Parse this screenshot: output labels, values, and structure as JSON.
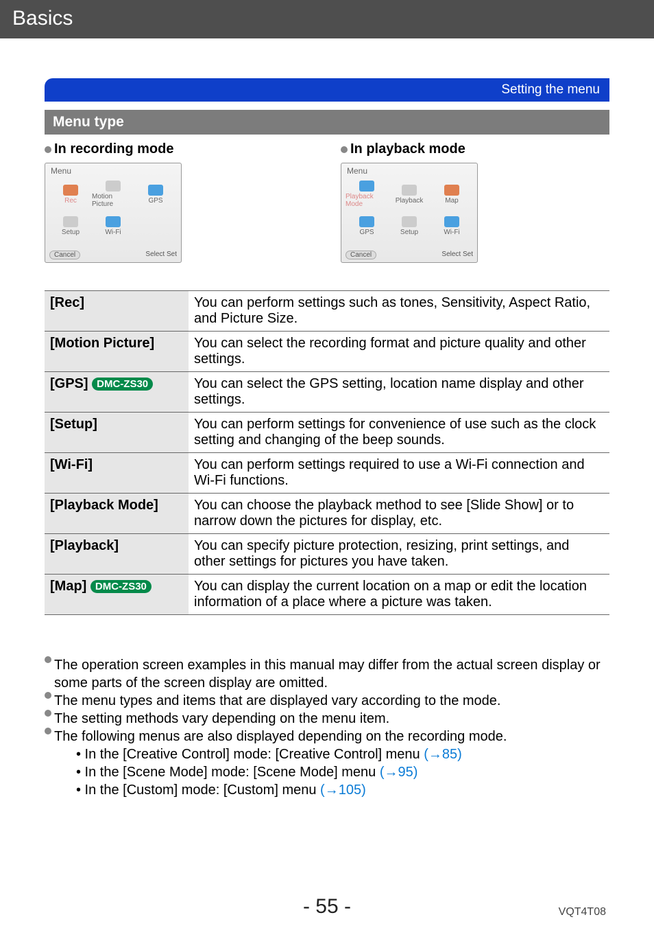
{
  "header": "Basics",
  "section_title": "Setting the menu",
  "subheading": "Menu type",
  "modes": {
    "recording": "In recording mode",
    "playback": "In playback mode"
  },
  "rec_menu": {
    "title": "Menu",
    "items": [
      "Rec",
      "Motion Picture",
      "GPS",
      "Setup",
      "Wi-Fi"
    ],
    "cancel": "Cancel",
    "select": "Select      Set"
  },
  "play_menu": {
    "title": "Menu",
    "items": [
      "Playback Mode",
      "Playback",
      "Map",
      "GPS",
      "Setup",
      "Wi-Fi"
    ],
    "cancel": "Cancel",
    "select": "Select      Set"
  },
  "table": [
    {
      "label": "[Rec]",
      "badge": "",
      "desc": "You can perform settings such as tones, Sensitivity, Aspect Ratio, and Picture Size."
    },
    {
      "label": "[Motion Picture]",
      "badge": "",
      "desc": "You can select the recording format and picture quality and other settings."
    },
    {
      "label": "[GPS]",
      "badge": "DMC-ZS30",
      "desc": "You can select the GPS setting, location name display and other settings."
    },
    {
      "label": "[Setup]",
      "badge": "",
      "desc": "You can perform settings for convenience of use such as the clock setting and changing of the beep sounds."
    },
    {
      "label": "[Wi-Fi]",
      "badge": "",
      "desc": "You can perform settings required to use a Wi-Fi connection and Wi-Fi functions."
    },
    {
      "label": "[Playback Mode]",
      "badge": "",
      "desc": "You can choose the playback method to see [Slide Show] or to narrow down the pictures for display, etc."
    },
    {
      "label": "[Playback]",
      "badge": "",
      "desc": "You can specify picture protection, resizing, print settings, and other settings for pictures you have taken."
    },
    {
      "label": "[Map]",
      "badge": "DMC-ZS30",
      "desc": "You can display the current location on a map or edit the location information of a place where a picture was taken."
    }
  ],
  "notes": {
    "n1": "The operation screen examples in this manual may differ from the actual screen display or some parts of the screen display are omitted.",
    "n2": "The menu types and items that are displayed vary according to the mode.",
    "n3": "The setting methods vary depending on the menu item.",
    "n4": "The following menus are also displayed depending on the recording mode.",
    "s1a": "• In the [Creative Control] mode: [Creative Control] menu ",
    "s1b": "(→85)",
    "s2a": "• In the [Scene Mode] mode: [Scene Mode] menu ",
    "s2b": "(→95)",
    "s3a": "• In the [Custom] mode: [Custom] menu ",
    "s3b": "(→105)"
  },
  "page_number": "- 55 -",
  "doc_id": "VQT4T08"
}
